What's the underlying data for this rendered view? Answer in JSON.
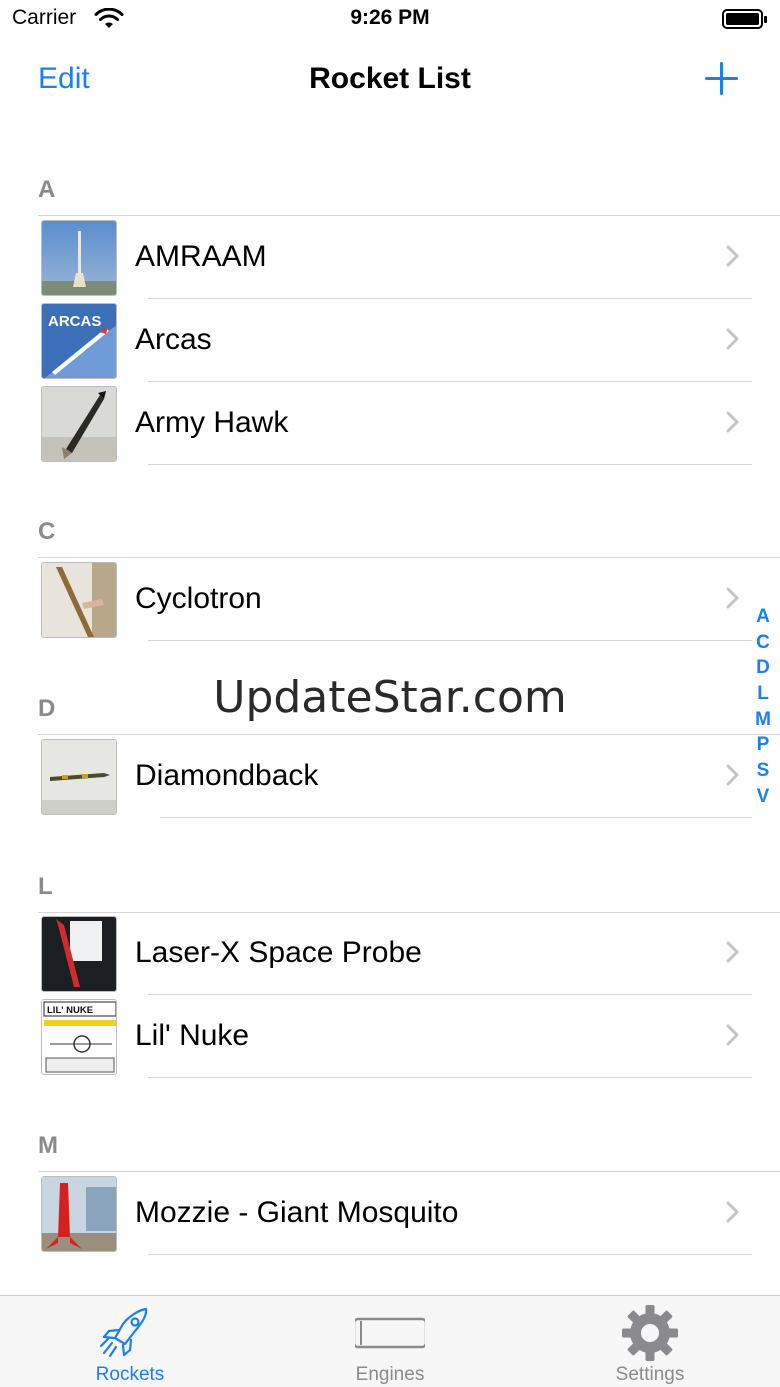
{
  "status_bar": {
    "carrier": "Carrier",
    "time": "9:26 PM"
  },
  "nav": {
    "edit_label": "Edit",
    "title": "Rocket List"
  },
  "sections": [
    {
      "letter": "A",
      "items": [
        "AMRAAM",
        "Arcas",
        "Army Hawk"
      ]
    },
    {
      "letter": "C",
      "items": [
        "Cyclotron"
      ]
    },
    {
      "letter": "D",
      "items": [
        "Diamondback"
      ]
    },
    {
      "letter": "L",
      "items": [
        "Laser-X Space Probe",
        "Lil' Nuke"
      ]
    },
    {
      "letter": "M",
      "items": [
        "Mozzie - Giant Mosquito"
      ]
    }
  ],
  "thumbnails": {
    "arcas_text": "ARCAS",
    "lilnuke_text": "LIL' NUKE"
  },
  "index": [
    "A",
    "C",
    "D",
    "L",
    "M",
    "P",
    "S",
    "V"
  ],
  "watermark": "UpdateStar.com",
  "tabs": [
    {
      "label": "Rockets",
      "icon": "rocket-icon",
      "selected": true
    },
    {
      "label": "Engines",
      "icon": "engine-icon",
      "selected": false
    },
    {
      "label": "Settings",
      "icon": "gear-icon",
      "selected": false
    }
  ],
  "colors": {
    "accent": "#1a7ff0",
    "inactive": "#8a8a8e"
  }
}
